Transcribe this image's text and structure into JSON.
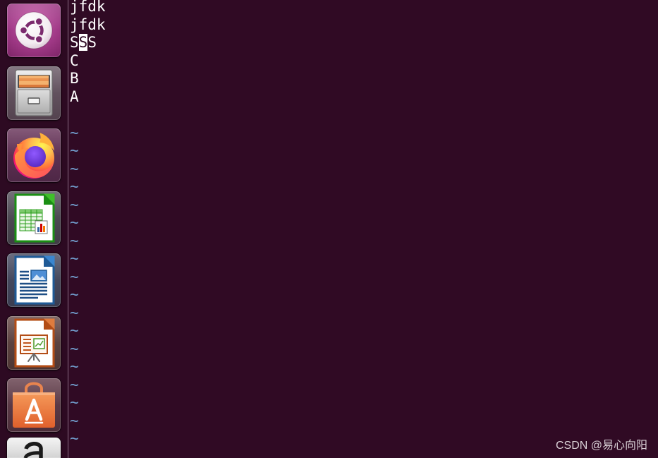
{
  "launcher": {
    "items": [
      {
        "icon": "ubuntu-dash-icon"
      },
      {
        "icon": "files-icon"
      },
      {
        "icon": "firefox-icon"
      },
      {
        "icon": "libreoffice-calc-icon"
      },
      {
        "icon": "libreoffice-writer-icon"
      },
      {
        "icon": "libreoffice-impress-icon"
      },
      {
        "icon": "ubuntu-software-icon"
      },
      {
        "icon": "amazon-icon"
      }
    ]
  },
  "editor": {
    "lines": [
      "jfdk",
      "jfdk",
      "SSS",
      "C",
      "B",
      "A",
      ""
    ],
    "cursor": {
      "line": 3,
      "column": 2
    },
    "empty_line_markers": [
      "~",
      "~",
      "~",
      "~",
      "~",
      "~",
      "~",
      "~",
      "~",
      "~",
      "~",
      "~",
      "~",
      "~",
      "~",
      "~",
      "~",
      "~"
    ]
  },
  "watermark": "CSDN @易心向阳",
  "colors": {
    "background": "#300a24",
    "launcher_bg": "#2d0a22",
    "separator": "#86687f",
    "text": "#ffffff",
    "tilde": "#729fcf",
    "cursor_bg": "#ffffff",
    "cursor_fg": "#300a24",
    "watermark": "#d9d0d6"
  }
}
